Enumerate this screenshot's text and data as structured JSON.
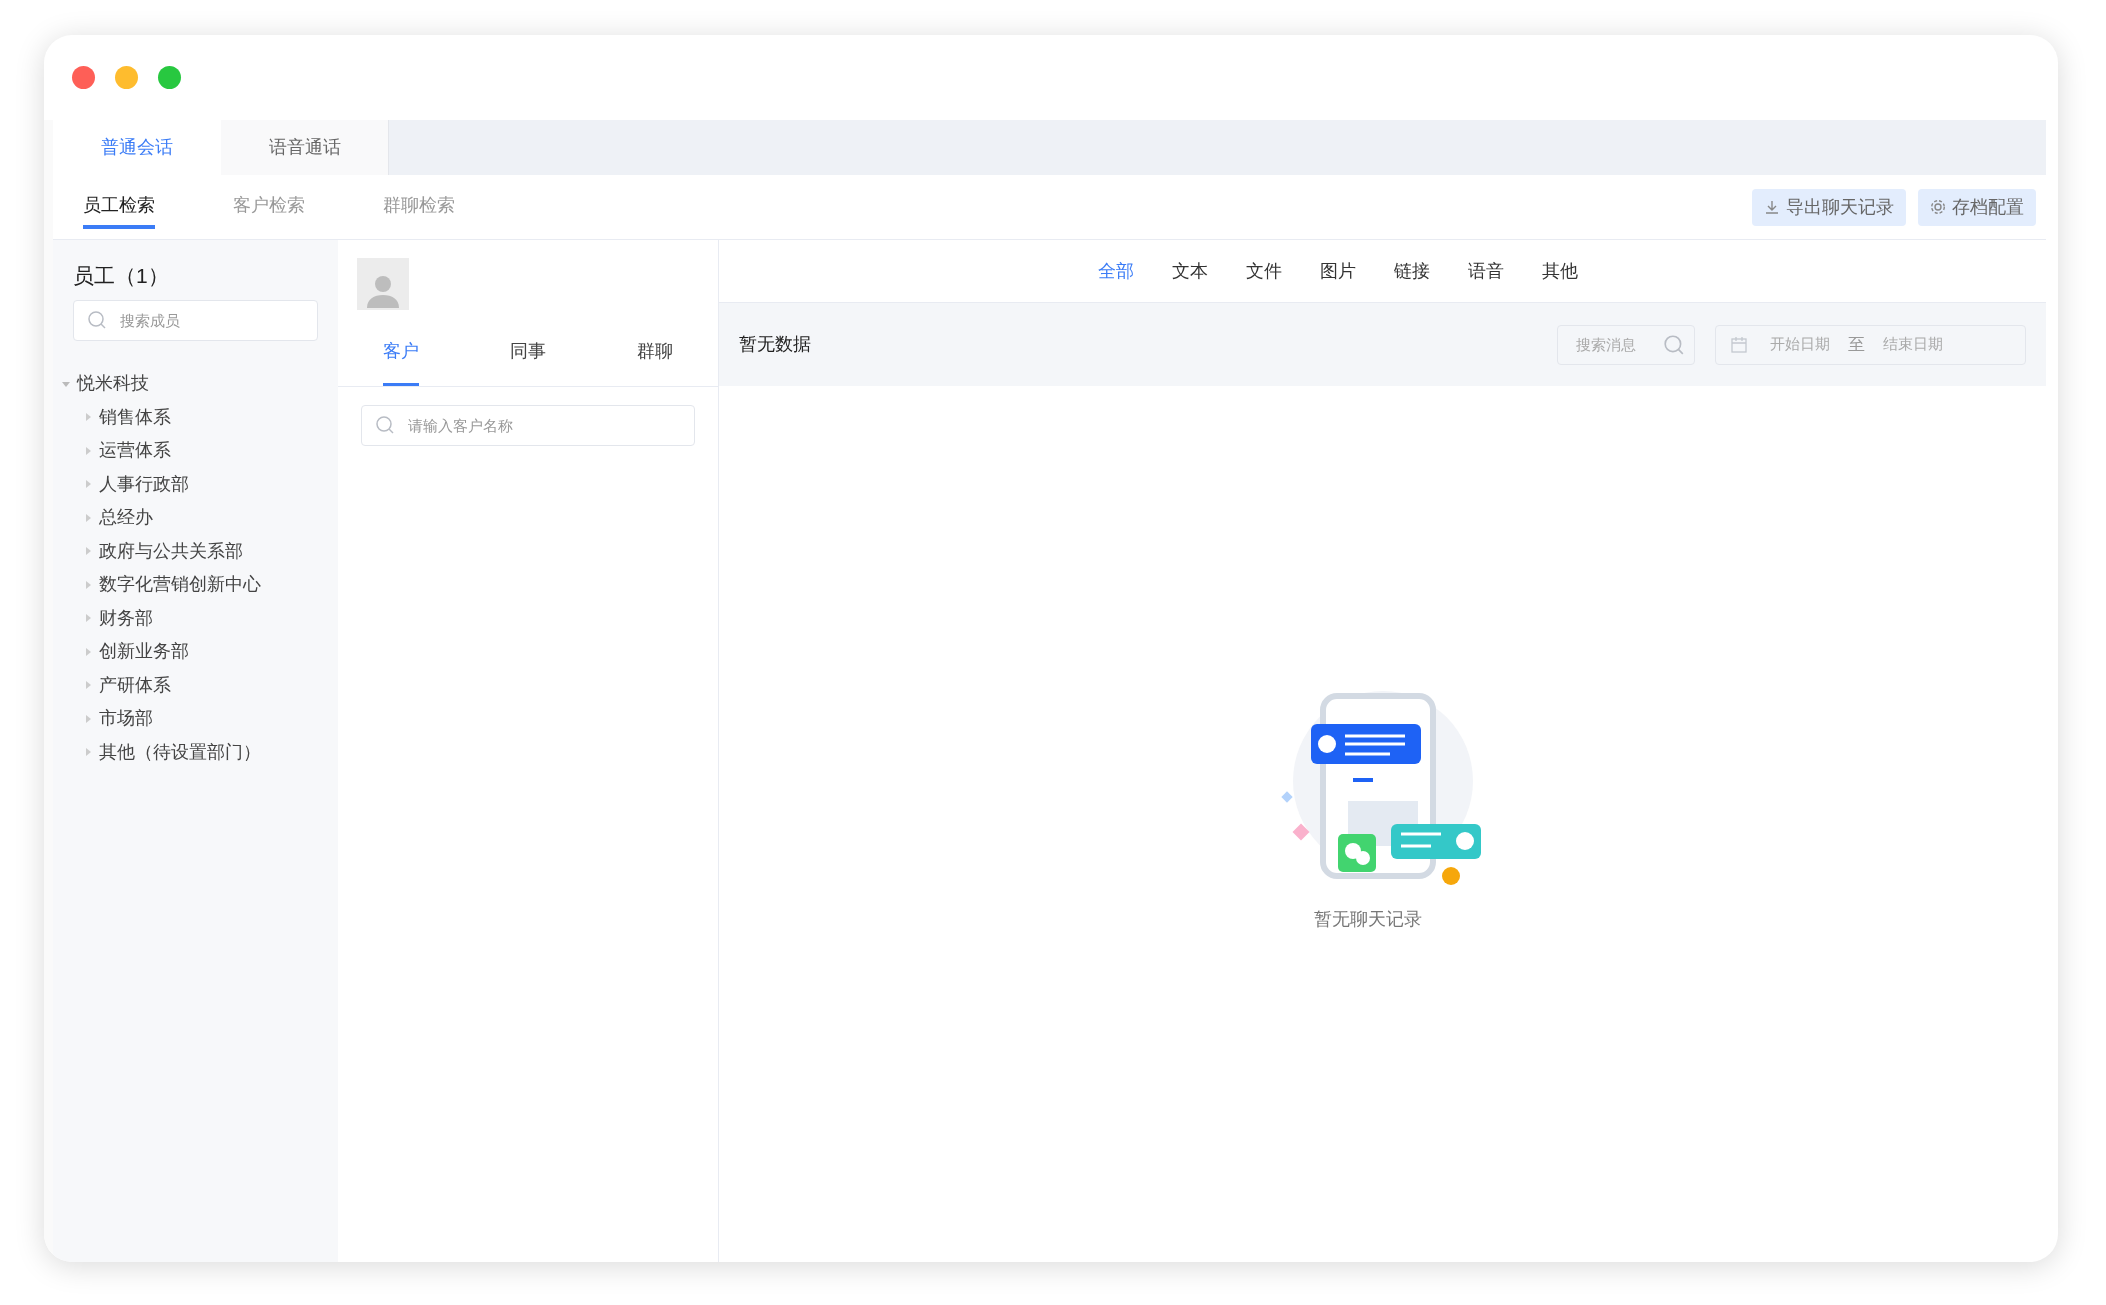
{
  "top_tabs": [
    {
      "label": "普通会话",
      "selected": true
    },
    {
      "label": "语音通话",
      "selected": false
    }
  ],
  "search_tabs": [
    {
      "label": "员工检索",
      "selected": true
    },
    {
      "label": "客户检索",
      "selected": false
    },
    {
      "label": "群聊检索",
      "selected": false
    }
  ],
  "actions": [
    {
      "kind": "download",
      "label": "导出聊天记录"
    },
    {
      "kind": "settings",
      "label": "存档配置"
    }
  ],
  "sidebar": {
    "title": "员工（1）",
    "search": {
      "placeholder": "搜索成员"
    },
    "tree": [
      {
        "label": "悦米科技",
        "expanded": true,
        "children": [
          {
            "label": "销售体系",
            "expanded": false
          },
          {
            "label": "运营体系",
            "expanded": false
          },
          {
            "label": "人事行政部",
            "expanded": false
          },
          {
            "label": "总经办",
            "expanded": false
          },
          {
            "label": "政府与公共关系部",
            "expanded": false
          },
          {
            "label": "数字化营销创新中心",
            "expanded": false
          },
          {
            "label": "财务部",
            "expanded": false
          },
          {
            "label": "创新业务部",
            "expanded": false
          },
          {
            "label": "产研体系",
            "expanded": false
          },
          {
            "label": "市场部",
            "expanded": false
          },
          {
            "label": "其他（待设置部门）",
            "expanded": false
          }
        ]
      }
    ]
  },
  "contacts": {
    "tabs": [
      {
        "label": "客户",
        "selected": true
      },
      {
        "label": "同事",
        "selected": false
      },
      {
        "label": "群聊",
        "selected": false
      }
    ],
    "search": {
      "placeholder": "请输入客户名称"
    }
  },
  "messages": {
    "type_tabs": [
      {
        "label": "全部",
        "selected": true
      },
      {
        "label": "文本",
        "selected": false
      },
      {
        "label": "文件",
        "selected": false
      },
      {
        "label": "图片",
        "selected": false
      },
      {
        "label": "链接",
        "selected": false
      },
      {
        "label": "语音",
        "selected": false
      },
      {
        "label": "其他",
        "selected": false
      }
    ],
    "status": "暂无数据",
    "search": {
      "placeholder": "搜索消息"
    },
    "date_range": {
      "start_placeholder": "开始日期",
      "separator": "至",
      "end_placeholder": "结束日期"
    },
    "empty_text": "暂无聊天记录"
  }
}
